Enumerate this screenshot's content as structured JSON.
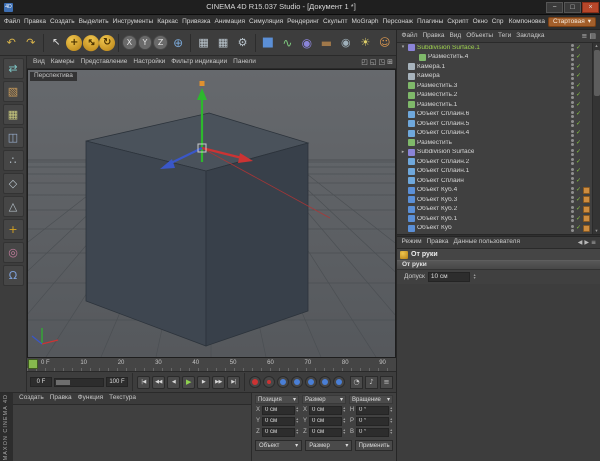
{
  "window": {
    "icon_label": "4D",
    "title": "CINEMA 4D R15.037 Studio - [Документ 1 *]",
    "minimize": "−",
    "maximize": "□",
    "close": "×"
  },
  "menu_bar": {
    "items": [
      "Файл",
      "Правка",
      "Создать",
      "Выделить",
      "Инструменты",
      "Каркас",
      "Привязка",
      "Анимация",
      "Симуляция",
      "Рендеринг",
      "Скульпт",
      "MoGraph",
      "Персонаж",
      "Плагины",
      "Скрипт",
      "Окно",
      "Спр"
    ],
    "layout_label": "Компоновка",
    "layout_value": "Стартовая",
    "layout_arrow": "▾"
  },
  "toolbar": {
    "undo": "↶",
    "redo": "↷",
    "selection": "↖",
    "move": "+",
    "scale": "↔",
    "rotate": "↻",
    "axis_x": "X",
    "axis_y": "Y",
    "axis_z": "Z",
    "coord_system": "⊕",
    "render_view": "▦",
    "render_picture_viewer": "▦",
    "render_settings": "⚙",
    "add_cube": "■",
    "spline_pen": "∿",
    "subdivision": "◉",
    "floor": "▬",
    "camera": "◉",
    "light": "☀",
    "character": "☺"
  },
  "left_toolbar": {
    "make_editable": "⇄",
    "model_mode": "▧",
    "texture_mode": "▦",
    "workplane_mode": "◫",
    "points_mode": "∴",
    "edges_mode": "◇",
    "polygons_mode": "△",
    "enable_axis": "+",
    "viewport_solo": "◎",
    "snap": "Ω"
  },
  "viewport": {
    "label": "Перспектива",
    "menu": [
      "Вид",
      "Камеры",
      "Представление",
      "Настройки",
      "Фильтр индикации",
      "Панели"
    ],
    "layout_icons": [
      "◰",
      "◱",
      "◳",
      "⊞"
    ]
  },
  "timeline": {
    "ticks": [
      "0 F",
      "10",
      "20",
      "30",
      "40",
      "50",
      "60",
      "70",
      "80",
      "90"
    ],
    "range_start": "0 F",
    "range_end": "100 F",
    "transport": {
      "to_start": "|◀",
      "prev_key": "◀◀",
      "prev_frame": "◀",
      "play": "▶",
      "next_frame": "▶",
      "next_key": "▶▶",
      "to_end": "▶|"
    },
    "extra_icons": [
      "◔",
      "♪",
      "≡"
    ]
  },
  "material_manager": {
    "menu": [
      "Создать",
      "Правка",
      "Функция",
      "Текстура"
    ]
  },
  "brand": {
    "vertical_text": "MAXON CINEMA 4D"
  },
  "coordinates": {
    "groups": [
      {
        "label": "Позиция",
        "rows": [
          {
            "axis": "X",
            "value": "0 см"
          },
          {
            "axis": "Y",
            "value": "0 см"
          },
          {
            "axis": "Z",
            "value": "0 см"
          }
        ]
      },
      {
        "label": "Размер",
        "rows": [
          {
            "axis": "X",
            "value": "0 см"
          },
          {
            "axis": "Y",
            "value": "0 см"
          },
          {
            "axis": "Z",
            "value": "0 см"
          }
        ]
      },
      {
        "label": "Вращение",
        "rows": [
          {
            "axis": "H",
            "value": "0 °"
          },
          {
            "axis": "P",
            "value": "0 °"
          },
          {
            "axis": "B",
            "value": "0 °"
          }
        ]
      }
    ],
    "mode_dropdown": "Объект",
    "size_dropdown": "Размер",
    "apply_button": "Применить",
    "dropdown_arrow": "▾"
  },
  "object_manager": {
    "menu": [
      "Файл",
      "Правка",
      "Вид",
      "Объекты",
      "Теги",
      "Закладка"
    ],
    "panel_icons": [
      "≡",
      "▤"
    ],
    "check_glyph": "✓",
    "objects": [
      {
        "name": "Subdivision Surface.1",
        "icon": "ic-subdiv",
        "state": "selected",
        "expand": "▾"
      },
      {
        "name": "Разместить.4",
        "icon": "ic-gen",
        "state": "child"
      },
      {
        "name": "Камера.1",
        "icon": "ic-cam"
      },
      {
        "name": "Камера",
        "icon": "ic-cam"
      },
      {
        "name": "Разместить.3",
        "icon": "ic-gen"
      },
      {
        "name": "Разместить.2",
        "icon": "ic-gen"
      },
      {
        "name": "Разместить.1",
        "icon": "ic-gen"
      },
      {
        "name": "Объект Сплайн.6",
        "icon": "ic-spline"
      },
      {
        "name": "Объект Сплайн.5",
        "icon": "ic-spline"
      },
      {
        "name": "Объект Сплайн.4",
        "icon": "ic-spline"
      },
      {
        "name": "Разместить",
        "icon": "ic-gen"
      },
      {
        "name": "Subdivision Surface",
        "icon": "ic-subdiv",
        "expand": "▸"
      },
      {
        "name": "Объект Сплайн.2",
        "icon": "ic-spline"
      },
      {
        "name": "Объект Сплайн.1",
        "icon": "ic-spline"
      },
      {
        "name": "Объект Сплайн",
        "icon": "ic-spline"
      },
      {
        "name": "Объект Куб.4",
        "icon": "ic-cube",
        "tag": "texture-tag"
      },
      {
        "name": "Объект Куб.3",
        "icon": "ic-cube",
        "tag": "texture-tag"
      },
      {
        "name": "Объект Куб.2",
        "icon": "ic-cube",
        "tag": "texture-tag"
      },
      {
        "name": "Объект Куб.1",
        "icon": "ic-cube",
        "tag": "texture-tag"
      },
      {
        "name": "Объект Куб",
        "icon": "ic-cube",
        "tag": "texture-tag"
      }
    ]
  },
  "attribute_manager": {
    "tabs": [
      "Режим",
      "Правка",
      "Данные пользователя"
    ],
    "nav_icons": [
      "◀",
      "▶",
      "≡"
    ],
    "title": "От руки",
    "section": "От руки",
    "tolerance_label": "Допуск",
    "tolerance_value": "10 см"
  },
  "colors": {
    "selected_object_text": "#9fd24f",
    "layout_pill": "#a35f2b",
    "axis_x": "#cc3333",
    "axis_y": "#2db82d",
    "axis_z": "#3a57c8",
    "texture_tag": "#cd8c3f",
    "cube_face": "#3e4650",
    "viewport_bg": "#5c5f63"
  }
}
